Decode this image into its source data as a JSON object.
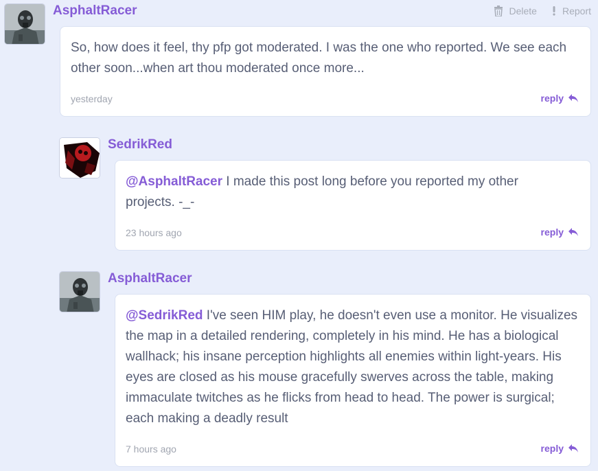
{
  "actions": {
    "delete_label": "Delete",
    "report_label": "Report"
  },
  "reply_label": "reply",
  "comments": [
    {
      "username": "AsphaltRacer",
      "mention": "",
      "body": "So, how does it feel, thy pfp got moderated. I was the one who reported. We see each other soon...when art thou moderated once more...",
      "time": "yesterday"
    },
    {
      "username": "SedrikRed",
      "mention": "@AsphaltRacer",
      "body": " I made this post long before you reported my other projects. -_-",
      "time": "23 hours ago"
    },
    {
      "username": "AsphaltRacer",
      "mention": "@SedrikRed",
      "body": " I've seen HIM play, he doesn't even use a monitor. He visualizes the map in a detailed rendering, completely in his mind. He has a biological wallhack; his insane perception highlights all enemies within light-years. His eyes are closed as his mouse gracefully swerves across the table, making immaculate twitches as he flicks from head to head. The power is surgical; each making a deadly result",
      "time": "7 hours ago"
    }
  ],
  "colors": {
    "accent": "#855cd6",
    "background": "#e9eefb",
    "text": "#575e75"
  }
}
